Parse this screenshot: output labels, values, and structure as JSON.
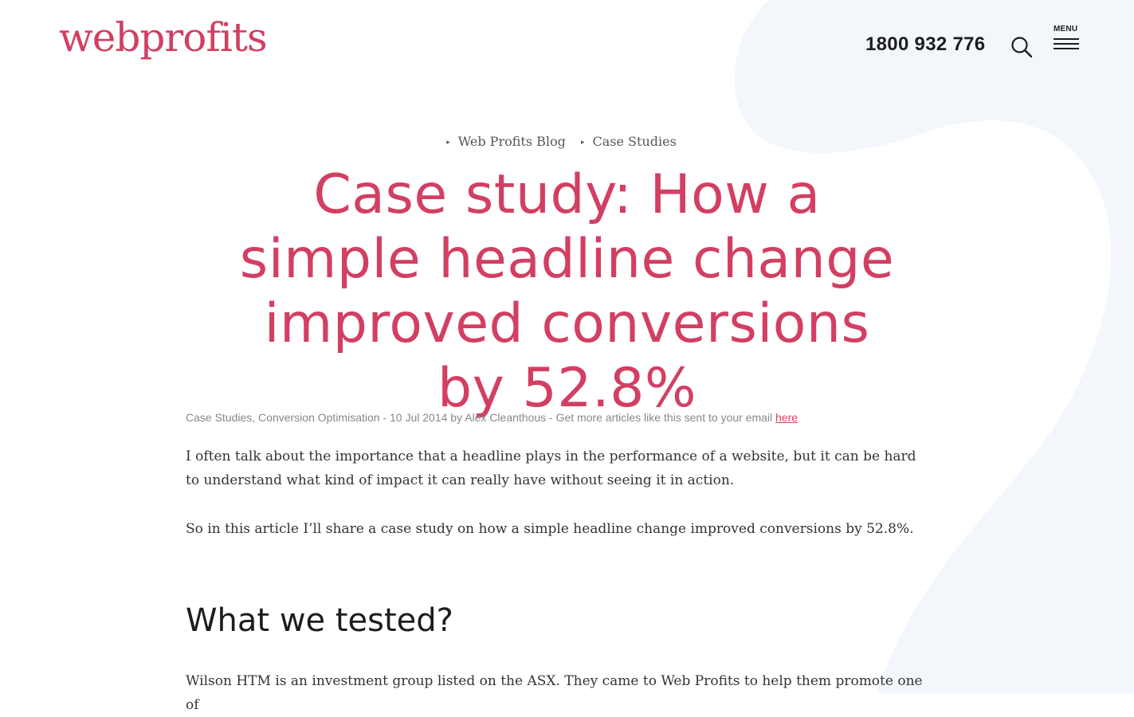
{
  "header": {
    "logo_text": "webprofits",
    "phone": "1800 932 776",
    "search_icon": "search-icon",
    "menu_label": "MENU",
    "menu_icon": "hamburger-icon"
  },
  "breadcrumb": {
    "items": [
      {
        "label": "Web Profits Blog"
      },
      {
        "label": "Case Studies"
      }
    ]
  },
  "article": {
    "title": "Case study: How a simple headline change improved conversions by 52.8%",
    "meta": {
      "categories": "Case Studies, Conversion Optimisation",
      "date_author": " - 10 Jul 2014 by Alex Cleanthous - Get more articles like this sent to your email ",
      "link_text": "here"
    },
    "paragraph_1": "I often talk about the importance that a headline plays in the performance of a website, but it can be hard to understand what kind of impact it can really have without seeing it in action.",
    "paragraph_2": "So in this article I’ll share a case study on how a simple headline change improved conversions by 52.8%.",
    "heading_1": "What we tested?",
    "paragraph_3": "Wilson HTM is an investment group listed on the ASX. They came to Web Profits to help them promote one of"
  },
  "colors": {
    "brand": "#d23f62",
    "text": "#333333",
    "meta": "#888888",
    "background_shape": "#f3f6fb"
  }
}
